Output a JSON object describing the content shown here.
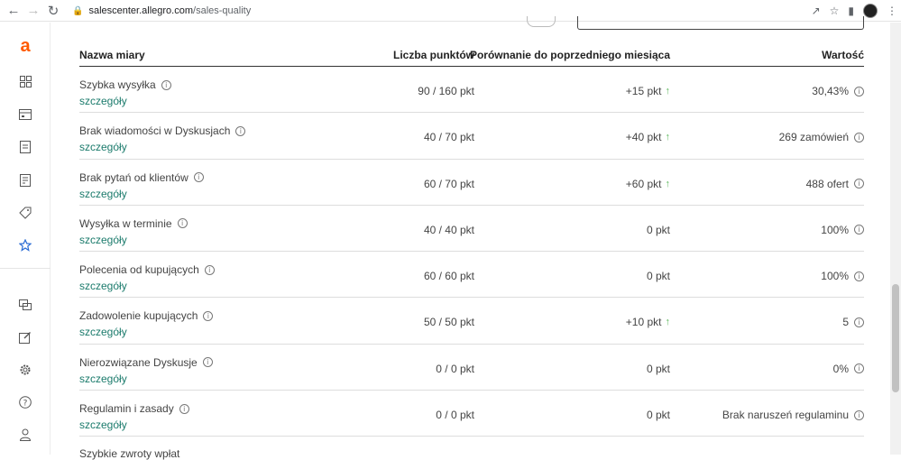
{
  "browser": {
    "url_host": "salescenter.allegro.com",
    "url_path": "/sales-quality"
  },
  "sidebar": {
    "logo": "a"
  },
  "table": {
    "headers": {
      "name": "Nazwa miary",
      "points": "Liczba punktów",
      "compare": "Porównanie do poprzedniego miesiąca",
      "value": "Wartość"
    },
    "details_label": "szczegóły",
    "rows": [
      {
        "name": "Szybka wysyłka",
        "points": "90 / 160 pkt",
        "compare": "+15 pkt",
        "up": true,
        "value": "30,43%"
      },
      {
        "name": "Brak wiadomości w Dyskusjach",
        "points": "40 / 70 pkt",
        "compare": "+40 pkt",
        "up": true,
        "value": "269 zamówień"
      },
      {
        "name": "Brak pytań od klientów",
        "points": "60 / 70 pkt",
        "compare": "+60 pkt",
        "up": true,
        "value": "488 ofert"
      },
      {
        "name": "Wysyłka w terminie",
        "points": "40 / 40 pkt",
        "compare": "0 pkt",
        "up": false,
        "value": "100%"
      },
      {
        "name": "Polecenia od kupujących",
        "points": "60 / 60 pkt",
        "compare": "0 pkt",
        "up": false,
        "value": "100%"
      },
      {
        "name": "Zadowolenie kupujących",
        "points": "50 / 50 pkt",
        "compare": "+10 pkt",
        "up": true,
        "value": "5"
      },
      {
        "name": "Nierozwiązane Dyskusje",
        "points": "0 / 0 pkt",
        "compare": "0 pkt",
        "up": false,
        "value": "0%"
      },
      {
        "name": "Regulamin i zasady",
        "points": "0 / 0 pkt",
        "compare": "0 pkt",
        "up": false,
        "value": "Brak naruszeń regulaminu"
      }
    ],
    "partial_row": "Szybkie zwroty wpłat"
  }
}
